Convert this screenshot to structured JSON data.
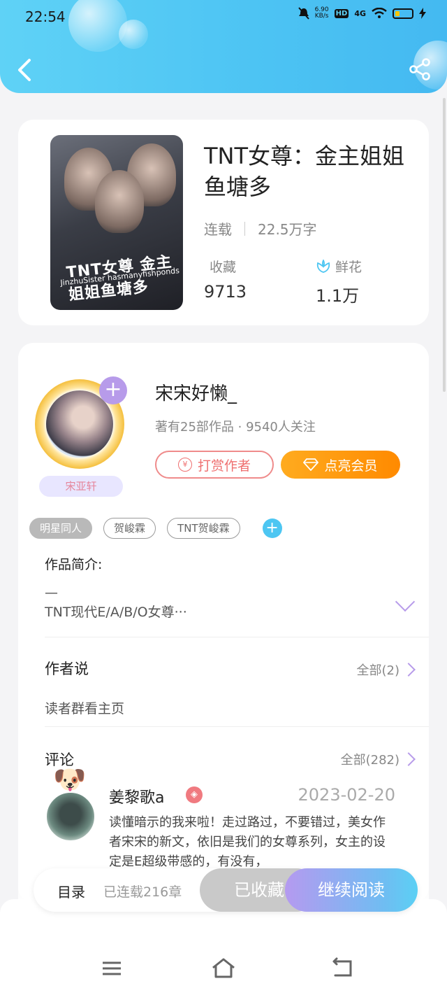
{
  "status_bar": {
    "time": "22:54",
    "speed": "6.90",
    "speed_unit": "KB/s",
    "hd": "HD",
    "network": "4G"
  },
  "header": {
    "back_icon": "back-chevron-icon",
    "share_icon": "share-icon"
  },
  "book": {
    "cover_title": "TNT女尊 金主姐姐鱼塘多",
    "cover_subtitle": "JinzhuSister hasmanyfishponds",
    "title": "TNT女尊：金主姐姐鱼塘多",
    "status": "连载",
    "word_count": "22.5万字",
    "stats": [
      {
        "label": "收藏",
        "value": "9713"
      },
      {
        "label": "鲜花",
        "value": "1.1万",
        "icon": "flower-icon"
      }
    ]
  },
  "author": {
    "name": "宋宋好懒_",
    "meta": "著有25部作品 · 9540人关注",
    "avatar_tag": "宋亚轩",
    "tip_button": "打赏作者",
    "vip_button": "点亮会员",
    "follow_plus": "+"
  },
  "tags": [
    "明星同人",
    "贺峻霖",
    "TNT贺峻霖"
  ],
  "intro": {
    "label": "作品简介:",
    "dash": "—",
    "text": "TNT现代E/A/B/O女尊···"
  },
  "author_says": {
    "label": "作者说",
    "all": "全部(2)",
    "text": "读者群看主页"
  },
  "comments": {
    "label": "评论",
    "all": "全部(282)",
    "items": [
      {
        "user": "姜黎歌a",
        "date": "2023-02-20",
        "text": "读懂暗示的我来啦！走过路过，不要错过，美女作者宋宋的新文，依旧是我们的女尊系列，女主的设定是E超级带感的，有没有，"
      }
    ]
  },
  "action_bar": {
    "toc": "目录",
    "serial": "已连载216章",
    "collected": "已收藏",
    "continue": "继续阅读"
  },
  "colors": {
    "header_start": "#5fd2f6",
    "accent_purple": "#b79bea",
    "vip_orange": "#ff8a00",
    "tip_red": "#ef7070"
  }
}
